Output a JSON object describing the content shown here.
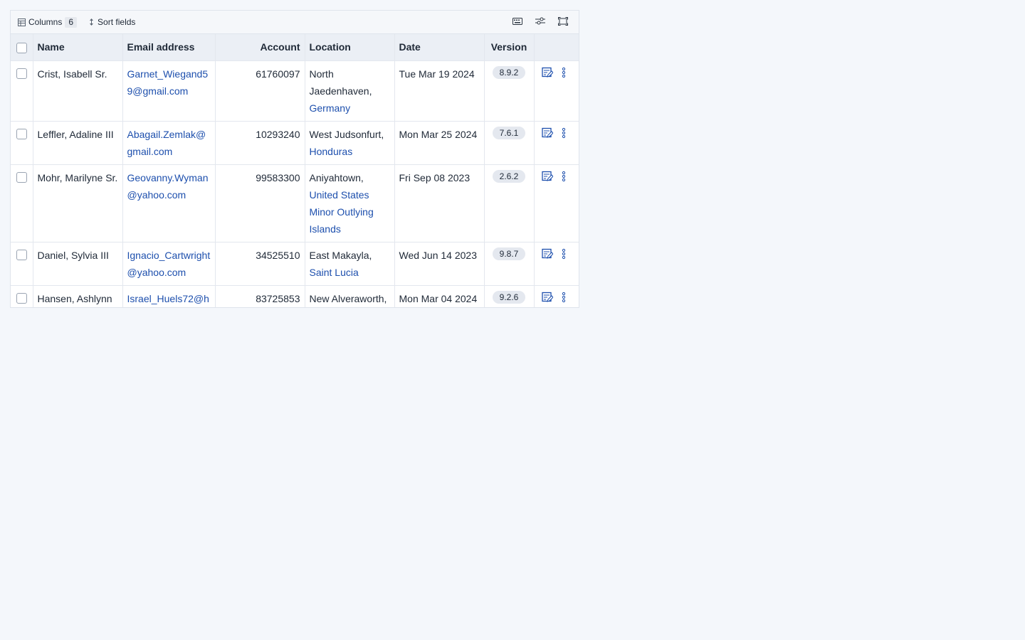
{
  "toolbar": {
    "columns_label": "Columns",
    "columns_count": "6",
    "sort_label": "Sort fields"
  },
  "table": {
    "headers": {
      "name": "Name",
      "email": "Email address",
      "account": "Account",
      "location": "Location",
      "date": "Date",
      "version": "Version"
    },
    "rows": [
      {
        "name": "Crist, Isabell Sr.",
        "email": "Garnet_Wiegand59@gmail.com",
        "account": "61760097",
        "city": "North Jaedenhaven,",
        "country": "Germany",
        "date": "Tue Mar 19 2024",
        "version": "8.9.2"
      },
      {
        "name": "Leffler, Adaline III",
        "email": "Abagail.Zemlak@gmail.com",
        "account": "10293240",
        "city": "West Judsonfurt,",
        "country": "Honduras",
        "date": "Mon Mar 25 2024",
        "version": "7.6.1"
      },
      {
        "name": "Mohr, Marilyne Sr.",
        "email": "Geovanny.Wyman@yahoo.com",
        "account": "99583300",
        "city": "Aniyahtown,",
        "country": "United States Minor Outlying Islands",
        "date": "Fri Sep 08 2023",
        "version": "2.6.2"
      },
      {
        "name": "Daniel, Sylvia III",
        "email": "Ignacio_Cartwright@yahoo.com",
        "account": "34525510",
        "city": "East Makayla,",
        "country": "Saint Lucia",
        "date": "Wed Jun 14 2023",
        "version": "9.8.7"
      },
      {
        "name": "Hansen, Ashlynn",
        "email": "Israel_Huels72@h",
        "account": "83725853",
        "city": "New Alveraworth,",
        "country": "",
        "date": "Mon Mar 04 2024",
        "version": "9.2.6"
      }
    ]
  },
  "colors": {
    "link": "#1d4fad",
    "header_bg": "#ebeff5",
    "page_bg": "#f4f7fb"
  },
  "icons": {
    "columns": "table-columns-icon",
    "sort": "sort-arrows-icon",
    "keyboard": "keyboard-icon",
    "filter": "sliders-icon",
    "fullscreen": "fullscreen-icon",
    "edit": "edit-form-icon",
    "more": "more-vertical-icon"
  }
}
